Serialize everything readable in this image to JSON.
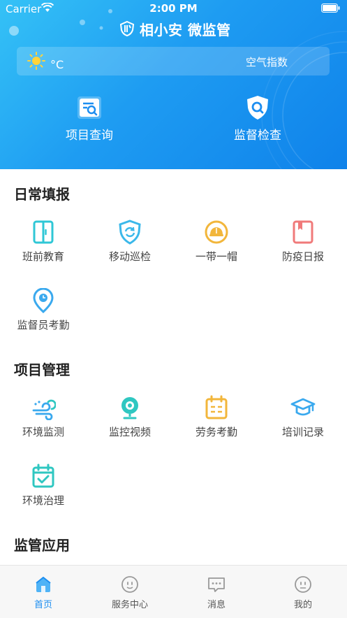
{
  "status_bar": {
    "carrier": "Carrier",
    "time": "2:00 PM"
  },
  "header": {
    "app_title": "相小安 微监管"
  },
  "weather": {
    "unit": "°C",
    "aqi_label": "空气指数"
  },
  "hero_actions": [
    {
      "label": "项目查询",
      "icon": "search-document-icon"
    },
    {
      "label": "监督检查",
      "icon": "shield-search-icon"
    }
  ],
  "sections": [
    {
      "title": "日常填报",
      "items": [
        {
          "label": "班前教育",
          "icon": "door-icon",
          "color": "#2fc7d6"
        },
        {
          "label": "移动巡检",
          "icon": "shield-refresh-icon",
          "color": "#3bb8ea"
        },
        {
          "label": "一带一帽",
          "icon": "helmet-icon",
          "color": "#f2b63b"
        },
        {
          "label": "防疫日报",
          "icon": "notebook-icon",
          "color": "#f07a7a"
        },
        {
          "label": "监督员考勤",
          "icon": "location-clock-icon",
          "color": "#3aa9ee"
        }
      ]
    },
    {
      "title": "项目管理",
      "items": [
        {
          "label": "环境监测",
          "icon": "wind-icon",
          "color": "#3aa9ee"
        },
        {
          "label": "监控视频",
          "icon": "camera-icon",
          "color": "#2fc7c1"
        },
        {
          "label": "劳务考勤",
          "icon": "calendar-list-icon",
          "color": "#f2b63b"
        },
        {
          "label": "培训记录",
          "icon": "graduation-cap-icon",
          "color": "#3aa9ee"
        },
        {
          "label": "环境治理",
          "icon": "calendar-check-icon",
          "color": "#2fc7c1"
        }
      ]
    },
    {
      "title": "监管应用",
      "items": []
    }
  ],
  "tabbar": [
    {
      "label": "首页",
      "icon": "home-icon",
      "active": true
    },
    {
      "label": "服务中心",
      "icon": "service-face-icon",
      "active": false
    },
    {
      "label": "消息",
      "icon": "message-icon",
      "active": false
    },
    {
      "label": "我的",
      "icon": "profile-face-icon",
      "active": false
    }
  ],
  "colors": {
    "accent": "#1d8ef0",
    "hero_start": "#35c2f6",
    "hero_end": "#0f82ea"
  }
}
